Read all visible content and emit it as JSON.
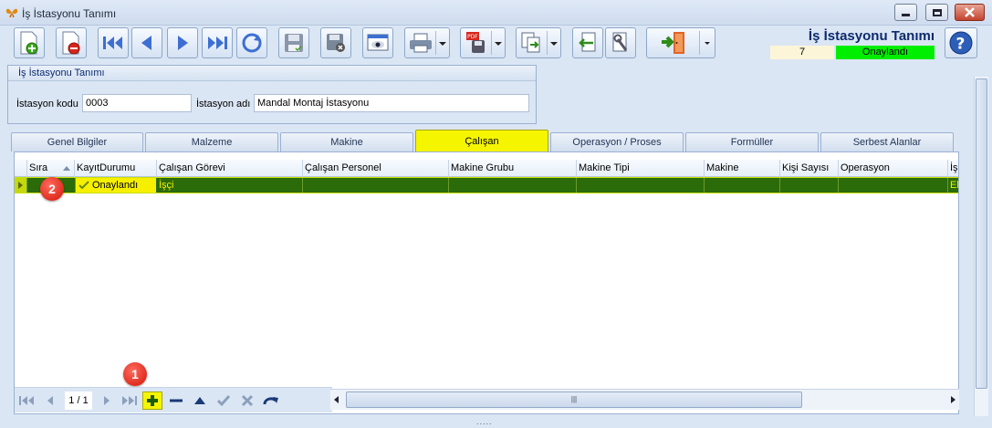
{
  "window": {
    "title": "İş İstasyonu Tanımı"
  },
  "header": {
    "title": "İş İstasyonu Tanımı",
    "record_no": "7",
    "status": "Onaylandı"
  },
  "toolbar": {
    "buttons": [
      "new-record",
      "delete-record",
      "first",
      "previous",
      "next",
      "last",
      "refresh",
      "save",
      "cancel-save",
      "preview",
      "print",
      "export-pdf",
      "copy",
      "import",
      "tools",
      "exit",
      "help"
    ]
  },
  "form": {
    "group_title": "İş İstasyonu Tanımı",
    "code_label": "İstasyon kodu",
    "code_value": "0003",
    "name_label": "İstasyon adı",
    "name_value": "Mandal Montaj İstasyonu"
  },
  "tabs": [
    "Genel Bilgiler",
    "Malzeme",
    "Makine",
    "Çalışan",
    "Operasyon / Proses",
    "Formüller",
    "Serbest Alanlar"
  ],
  "active_tab": "Çalışan",
  "grid": {
    "columns": [
      "Sıra",
      "KayıtDurumu",
      "Çalışan Görevi",
      "Çalışan Personel",
      "Makine Grubu",
      "Makine Tipi",
      "Makine",
      "Kişi Sayısı",
      "Operasyon",
      "İş"
    ],
    "rows": [
      {
        "sira": "",
        "kayit_durumu": "Onaylandı",
        "calisan_gorevi": "İşçi",
        "calisan_personel": "",
        "makine_grubu": "",
        "makine_tipi": "",
        "makine": "",
        "kisi_sayisi": "",
        "operasyon": "",
        "is": "El"
      }
    ]
  },
  "navigator": {
    "page": "1 / 1"
  },
  "callouts": [
    "1",
    "2"
  ],
  "colors": {
    "selected_row": "#2b6b0a",
    "row_text": "#f6f000",
    "active_tab": "#f5f500",
    "status_ok": "#00ee00"
  }
}
